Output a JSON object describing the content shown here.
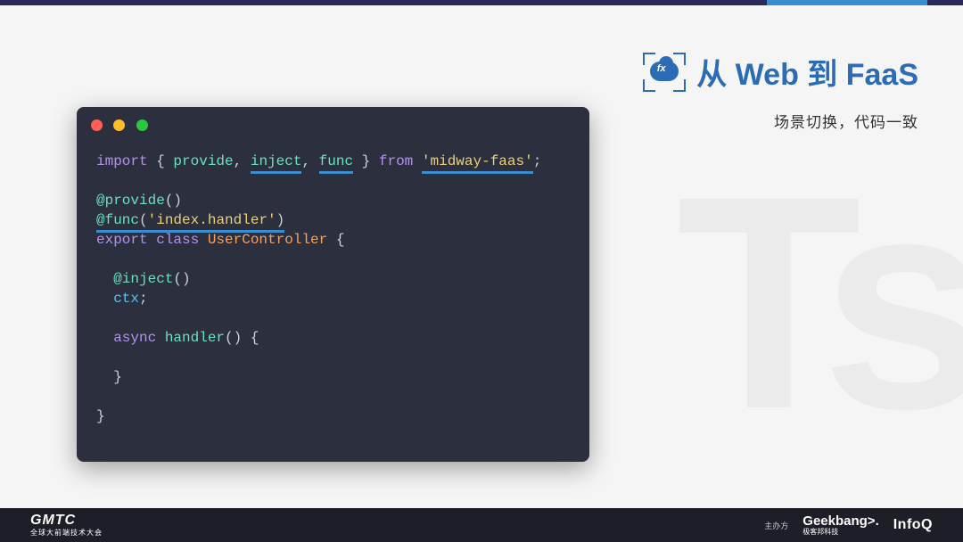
{
  "header": {
    "icon_fx": "fx",
    "title": "从 Web 到 FaaS",
    "subtitle": "场景切换，代码一致"
  },
  "code": {
    "l1_import": "import",
    "l1_open": " { ",
    "l1_provide": "provide",
    "l1_c1": ", ",
    "l1_inject": "inject",
    "l1_c2": ", ",
    "l1_func": "func",
    "l1_close": " } ",
    "l1_from": "from",
    "l1_sp": " ",
    "l1_pkg": "'midway-faas'",
    "l1_semi": ";",
    "l3_provide": "@provide",
    "l3_paren": "()",
    "l4_func": "@func",
    "l4_open": "(",
    "l4_arg": "'index.handler'",
    "l4_close": ")",
    "l5_export": "export",
    "l5_class": " class",
    "l5_name": " UserController",
    "l5_brace": " {",
    "l7_inject": "  @inject",
    "l7_paren": "()",
    "l8_ctx": "  ctx",
    "l8_semi": ";",
    "l10_async": "  async",
    "l10_handler": " handler",
    "l10_rest": "() {",
    "l12_close": "  }",
    "l14_close": "}"
  },
  "footer": {
    "gmtc": "GMTC",
    "gmtc_sub": "全球大前端技术大会",
    "zhub": "主办方",
    "geek": "Geekbang>.",
    "geek_sub": "极客邦科技",
    "infoq": "InfoQ"
  },
  "watermark": "Ts"
}
